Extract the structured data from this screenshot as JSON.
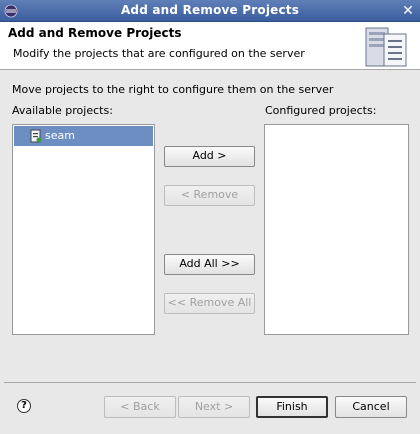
{
  "window": {
    "title": "Add and Remove Projects"
  },
  "header": {
    "title": "Add and Remove Projects",
    "description": "Modify the projects that are configured on the server"
  },
  "instruction": "Move projects to the right to configure them on the server",
  "available": {
    "label": "Available projects:",
    "items": [
      {
        "label": "seam",
        "selected": true
      }
    ]
  },
  "configured": {
    "label": "Configured projects:",
    "items": []
  },
  "buttons": {
    "add": "Add >",
    "remove": "< Remove",
    "add_all": "Add All >>",
    "remove_all": "<< Remove All"
  },
  "footer": {
    "back": "< Back",
    "next": "Next >",
    "finish": "Finish",
    "cancel": "Cancel",
    "help": "?"
  },
  "colors": {
    "titlebar": "#4b6da9",
    "selection": "#6d8ec3"
  }
}
